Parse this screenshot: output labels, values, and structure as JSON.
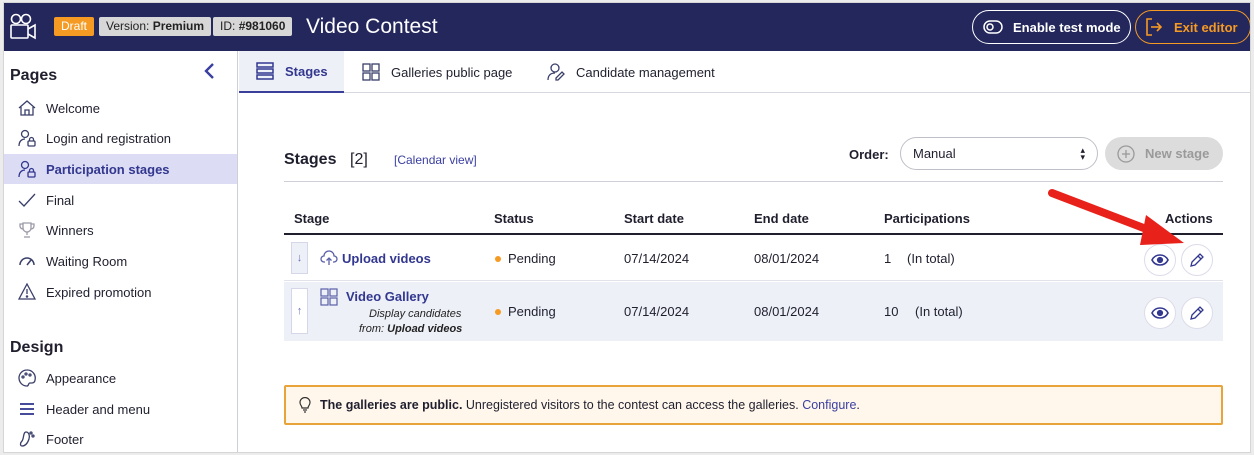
{
  "topbar": {
    "badge_draft": "Draft",
    "version_label": "Version:",
    "version_value": "Premium",
    "id_label": "ID:",
    "id_value": "#981060",
    "title": "Video Contest",
    "test_mode_label": "Enable test mode",
    "exit_label": "Exit editor"
  },
  "sidebar": {
    "pages_heading": "Pages",
    "design_heading": "Design",
    "pages": [
      {
        "label": "Welcome",
        "icon": "home-icon"
      },
      {
        "label": "Login and registration",
        "icon": "user-lock-icon"
      },
      {
        "label": "Participation stages",
        "icon": "user-lock-icon",
        "active": true
      },
      {
        "label": "Final",
        "icon": "check-icon"
      },
      {
        "label": "Winners",
        "icon": "trophy-icon"
      },
      {
        "label": "Waiting Room",
        "icon": "gauge-icon"
      },
      {
        "label": "Expired promotion",
        "icon": "warning-icon"
      }
    ],
    "design": [
      {
        "label": "Appearance",
        "icon": "palette-icon"
      },
      {
        "label": "Header and menu",
        "icon": "menu-icon"
      },
      {
        "label": "Footer",
        "icon": "foot-icon"
      }
    ]
  },
  "tabs": [
    {
      "label": "Stages",
      "active": true
    },
    {
      "label": "Galleries public page"
    },
    {
      "label": "Candidate management"
    }
  ],
  "main": {
    "stages_title": "Stages",
    "stages_count": "[2]",
    "calendar_view": "[Calendar view]",
    "order_label": "Order:",
    "order_value": "Manual",
    "new_stage_label": "New stage",
    "columns": [
      "Stage",
      "Status",
      "Start date",
      "End date",
      "Participations",
      "Actions"
    ],
    "rows": [
      {
        "handle": "↓",
        "name": "Upload videos",
        "status": "Pending",
        "start": "07/14/2024",
        "end": "08/01/2024",
        "participations": "1",
        "participations_note": "(In total)"
      },
      {
        "handle": "↑",
        "name": "Video Gallery",
        "sub1": "Display candidates",
        "sub2_prefix": "from: ",
        "sub2_value": "Upload videos",
        "status": "Pending",
        "start": "07/14/2024",
        "end": "08/01/2024",
        "participations": "10",
        "participations_note": "(In total)"
      }
    ],
    "notice_bold": "The galleries are public.",
    "notice_text": "Unregistered visitors to the contest can access the galleries.",
    "notice_link": "Configure",
    "notice_end": "."
  },
  "colors": {
    "topbar": "#24275c",
    "accent": "#32378f",
    "orange": "#f59a23",
    "annotation_arrow": "#e8211b"
  }
}
